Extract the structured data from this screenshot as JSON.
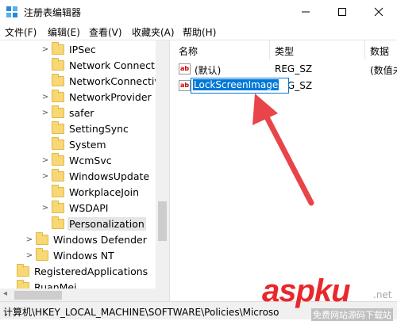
{
  "window": {
    "title": "注册表编辑器"
  },
  "menu": [
    "文件(F)",
    "编辑(E)",
    "查看(V)",
    "收藏夹(A)",
    "帮助(H)"
  ],
  "tree": {
    "items": [
      {
        "label": "IPSec",
        "indent": 3,
        "expander": ">"
      },
      {
        "label": "Network Connectic",
        "indent": 3,
        "expander": ""
      },
      {
        "label": "NetworkConnectivi",
        "indent": 3,
        "expander": ""
      },
      {
        "label": "NetworkProvider",
        "indent": 3,
        "expander": ">"
      },
      {
        "label": "safer",
        "indent": 3,
        "expander": ">"
      },
      {
        "label": "SettingSync",
        "indent": 3,
        "expander": ""
      },
      {
        "label": "System",
        "indent": 3,
        "expander": ""
      },
      {
        "label": "WcmSvc",
        "indent": 3,
        "expander": ">"
      },
      {
        "label": "WindowsUpdate",
        "indent": 3,
        "expander": ">"
      },
      {
        "label": "WorkplaceJoin",
        "indent": 3,
        "expander": ""
      },
      {
        "label": "WSDAPI",
        "indent": 3,
        "expander": ">"
      },
      {
        "label": "Personalization",
        "indent": 3,
        "expander": "",
        "selected": true
      },
      {
        "label": "Windows Defender",
        "indent": 2,
        "expander": ">"
      },
      {
        "label": "Windows NT",
        "indent": 2,
        "expander": ">"
      },
      {
        "label": "RegisteredApplications",
        "indent": 0,
        "expander": ""
      },
      {
        "label": "RuanMei",
        "indent": 0,
        "expander": ""
      }
    ]
  },
  "list": {
    "columns": [
      "名称",
      "类型",
      "数据"
    ],
    "rows": [
      {
        "name": "(默认)",
        "type": "REG_SZ",
        "data": "(数值未"
      },
      {
        "name": "LockScreenImage",
        "type": "REG_SZ",
        "data": "",
        "editing": true
      }
    ]
  },
  "status": {
    "path": "计算机\\HKEY_LOCAL_MACHINE\\SOFTWARE\\Policies\\Microso"
  },
  "watermark": {
    "main": "aspku",
    "net": ".net",
    "sub": "免费网站源码下载站"
  },
  "colors": {
    "accent": "#0078d7",
    "arrow": "#e8454a"
  }
}
